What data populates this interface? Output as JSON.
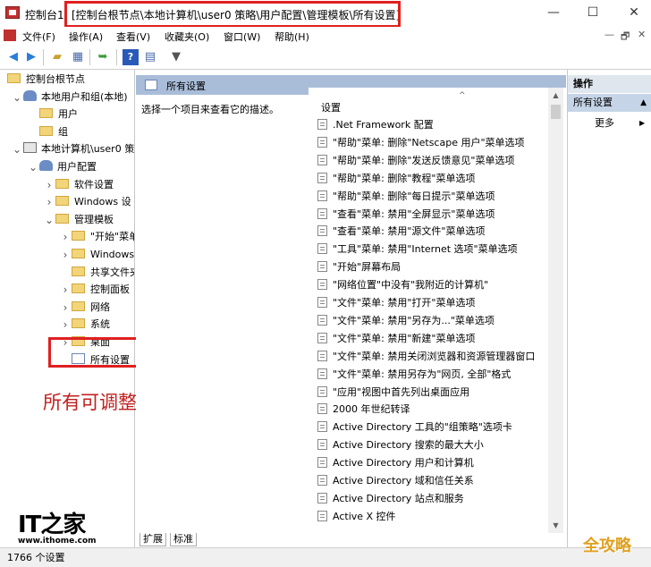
{
  "window": {
    "title": "控制台1",
    "path": "[控制台根节点\\本地计算机\\user0 策略\\用户配置\\管理模板\\所有设置]",
    "minimize": "—",
    "maximize": "☐",
    "close": "✕"
  },
  "menu": {
    "items": [
      "文件(F)",
      "操作(A)",
      "查看(V)",
      "收藏夹(O)",
      "窗口(W)",
      "帮助(H)"
    ],
    "right_min": "—",
    "right_restore": "🗗",
    "right_close": "✕"
  },
  "toolbar": {
    "icons": [
      "back-arrow-icon",
      "forward-arrow-icon",
      "up-folder-icon",
      "show-tree-icon",
      "export-icon",
      "help-icon",
      "view-icon",
      "filter-icon"
    ]
  },
  "tree": {
    "items": [
      {
        "label": "控制台根节点",
        "indent": 0,
        "chevron": "",
        "icon": "folder"
      },
      {
        "label": "本地用户和组(本地)",
        "indent": 1,
        "chevron": "v",
        "icon": "users"
      },
      {
        "label": "用户",
        "indent": 2,
        "chevron": "",
        "icon": "folder"
      },
      {
        "label": "组",
        "indent": 2,
        "chevron": "",
        "icon": "folder"
      },
      {
        "label": "本地计算机\\user0 策",
        "indent": 1,
        "chevron": "v",
        "icon": "pc"
      },
      {
        "label": "用户配置",
        "indent": 2,
        "chevron": "v",
        "icon": "user"
      },
      {
        "label": "软件设置",
        "indent": 3,
        "chevron": ">",
        "icon": "folder"
      },
      {
        "label": "Windows 设",
        "indent": 3,
        "chevron": ">",
        "icon": "folder"
      },
      {
        "label": "管理模板",
        "indent": 3,
        "chevron": "v",
        "icon": "folder"
      },
      {
        "label": "\"开始\"菜单",
        "indent": 4,
        "chevron": ">",
        "icon": "folder"
      },
      {
        "label": "Windows",
        "indent": 4,
        "chevron": ">",
        "icon": "folder"
      },
      {
        "label": "共享文件夹",
        "indent": 4,
        "chevron": "",
        "icon": "folder"
      },
      {
        "label": "控制面板",
        "indent": 4,
        "chevron": ">",
        "icon": "folder"
      },
      {
        "label": "网络",
        "indent": 4,
        "chevron": ">",
        "icon": "folder"
      },
      {
        "label": "系统",
        "indent": 4,
        "chevron": ">",
        "icon": "folder"
      },
      {
        "label": "桌面",
        "indent": 4,
        "chevron": ">",
        "icon": "folder"
      },
      {
        "label": "所有设置",
        "indent": 4,
        "chevron": "",
        "icon": "settings"
      }
    ]
  },
  "annotation": "所有可调整的功能在此",
  "logo": {
    "text": "IT之家",
    "url": "www.ithome.com"
  },
  "center": {
    "header": "所有设置",
    "description": "选择一个项目来查看它的描述。",
    "column": "设置",
    "sort_arrow": "^",
    "items": [
      ".Net Framework 配置",
      "\"帮助\"菜单: 删除\"Netscape 用户\"菜单选项",
      "\"帮助\"菜单: 删除\"发送反馈意见\"菜单选项",
      "\"帮助\"菜单: 删除\"教程\"菜单选项",
      "\"帮助\"菜单: 删除\"每日提示\"菜单选项",
      "\"查看\"菜单: 禁用\"全屏显示\"菜单选项",
      "\"查看\"菜单: 禁用\"源文件\"菜单选项",
      "\"工具\"菜单: 禁用\"Internet 选项\"菜单选项",
      "\"开始\"屏幕布局",
      "\"网络位置\"中没有\"我附近的计算机\"",
      "\"文件\"菜单: 禁用\"打开\"菜单选项",
      "\"文件\"菜单: 禁用\"另存为...\"菜单选项",
      "\"文件\"菜单: 禁用\"新建\"菜单选项",
      "\"文件\"菜单: 禁用关闭浏览器和资源管理器窗口",
      "\"文件\"菜单: 禁用另存为\"网页, 全部\"格式",
      "\"应用\"视图中首先列出桌面应用",
      "2000 年世纪转译",
      "Active Directory 工具的\"组策略\"选项卡",
      "Active Directory 搜索的最大大小",
      "Active Directory 用户和计算机",
      "Active Directory 域和信任关系",
      "Active Directory 站点和服务",
      "Active X 控件"
    ],
    "tabs": [
      "扩展",
      "标准"
    ]
  },
  "actions": {
    "header": "操作",
    "section": "所有设置",
    "more": "更多"
  },
  "status": "1766 个设置",
  "watermark": "全攻略"
}
